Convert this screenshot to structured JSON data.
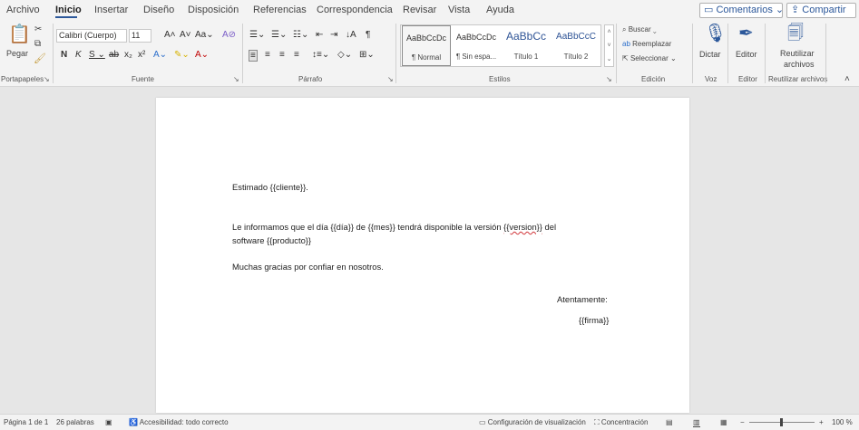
{
  "tabs": [
    "Archivo",
    "Inicio",
    "Insertar",
    "Diseño",
    "Disposición",
    "Referencias",
    "Correspondencia",
    "Revisar",
    "Vista",
    "Ayuda"
  ],
  "header": {
    "comments_label": "Comentarios",
    "share_label": "Compartir"
  },
  "clipboard": {
    "paste_label": "Pegar",
    "group_label": "Portapapeles"
  },
  "font": {
    "name": "Calibri (Cuerpo)",
    "size": "11",
    "group_label": "Fuente"
  },
  "paragraph": {
    "group_label": "Párrafo"
  },
  "styles": {
    "group_label": "Estilos",
    "items": [
      {
        "sample": "AaBbCcDc",
        "name": "¶ Normal"
      },
      {
        "sample": "AaBbCcDc",
        "name": "¶ Sin espa..."
      },
      {
        "sample": "AaBbCc",
        "name": "Título 1"
      },
      {
        "sample": "AaBbCcC",
        "name": "Título 2"
      }
    ]
  },
  "editing": {
    "find_label": "Buscar",
    "replace_label": "Reemplazar",
    "select_label": "Seleccionar",
    "group_label": "Edición"
  },
  "voice": {
    "dictate_label": "Dictar",
    "group_label": "Voz"
  },
  "editor": {
    "editor_label": "Editor",
    "group_label": "Editor"
  },
  "reuse": {
    "label_line1": "Reutilizar",
    "label_line2": "archivos",
    "group_label": "Reutilizar archivos"
  },
  "document": {
    "greeting": "Estimado {{cliente}}.",
    "body_line1_before": "Le informamos que el día {{día}} de {{mes}} tendrá disponible la versión ",
    "body_line1_flag": "{{version}}",
    "body_line1_after": " del",
    "body_line2": "software {{producto}}",
    "thanks": "Muchas gracias por confiar en nosotros.",
    "closing": "Atentamente:",
    "signature": "{{firma}}"
  },
  "status": {
    "page": "Página 1 de 1",
    "words": "26 palabras",
    "accessibility": "Accesibilidad: todo correcto",
    "display_settings": "Configuración de visualización",
    "focus": "Concentración",
    "zoom": "100 %"
  },
  "colors": {
    "accent": "#2b579a",
    "ribbon_bg": "#f3f3f3",
    "canvas_bg": "#e6e6e6",
    "spell_error": "#d13438"
  }
}
